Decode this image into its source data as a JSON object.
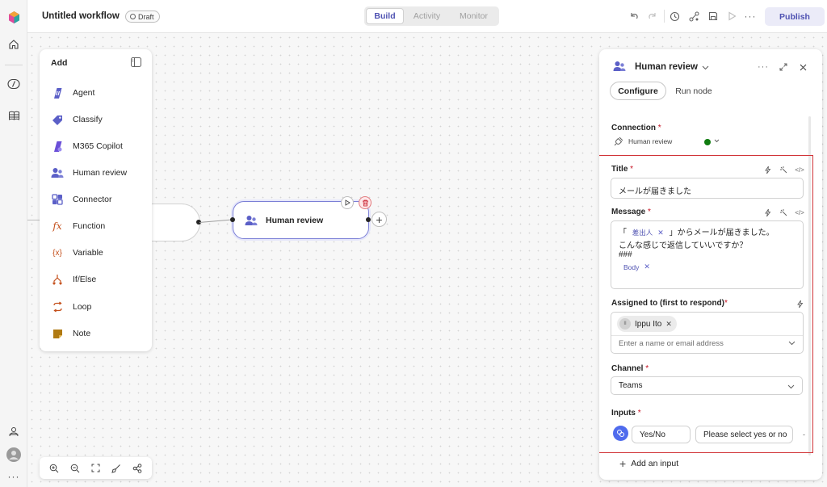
{
  "topbar": {
    "title": "Untitled workflow",
    "draft_label": "Draft",
    "tabs": [
      {
        "label": "Build",
        "active": true
      },
      {
        "label": "Activity",
        "active": false
      },
      {
        "label": "Monitor",
        "active": false
      }
    ],
    "publish_label": "Publish"
  },
  "add_panel": {
    "title": "Add",
    "items": [
      {
        "label": "Agent",
        "icon": "agent-icon",
        "color": "#5b5fc7"
      },
      {
        "label": "Classify",
        "icon": "tag-icon",
        "color": "#5b5fc7"
      },
      {
        "label": "M365 Copilot",
        "icon": "copilot-icon",
        "color": "#5b5fc7"
      },
      {
        "label": "Human review",
        "icon": "people-icon",
        "color": "#5b5fc7"
      },
      {
        "label": "Connector",
        "icon": "connector-icon",
        "color": "#5b5fc7"
      },
      {
        "label": "Function",
        "icon": "function-icon",
        "color": "#c4501c"
      },
      {
        "label": "Variable",
        "icon": "variable-icon",
        "color": "#c4501c"
      },
      {
        "label": "If/Else",
        "icon": "branch-icon",
        "color": "#c4501c"
      },
      {
        "label": "Loop",
        "icon": "loop-icon",
        "color": "#c4501c"
      },
      {
        "label": "Note",
        "icon": "note-icon",
        "color": "#8a5a00"
      }
    ]
  },
  "canvas": {
    "selected_node_label": "Human review"
  },
  "right_panel": {
    "title": "Human review",
    "tabs": {
      "configure": "Configure",
      "run_node": "Run node"
    },
    "connection": {
      "label": "Connection",
      "value": "Human review"
    },
    "title_field": {
      "label": "Title",
      "value": "メールが届きました"
    },
    "message": {
      "label": "Message",
      "line1_prefix": "「",
      "token1": "差出人",
      "line1_suffix": "」からメールが届きました。",
      "line2": "こんな感じで返信していいですか？",
      "line3": "###",
      "token2": "Body"
    },
    "assigned": {
      "label": "Assigned to (first to respond)",
      "person": "Ippu Ito",
      "person_initials": "II",
      "placeholder": "Enter a name or email address"
    },
    "channel": {
      "label": "Channel",
      "value": "Teams"
    },
    "inputs": {
      "label": "Inputs",
      "input_type": "Yes/No",
      "input_placeholder": "Please select yes or no"
    },
    "add_input_label": "Add an input"
  },
  "colors": {
    "accent": "#5b5fc7",
    "highlight_border": "#d13438",
    "connection_ok": "#107c10"
  }
}
